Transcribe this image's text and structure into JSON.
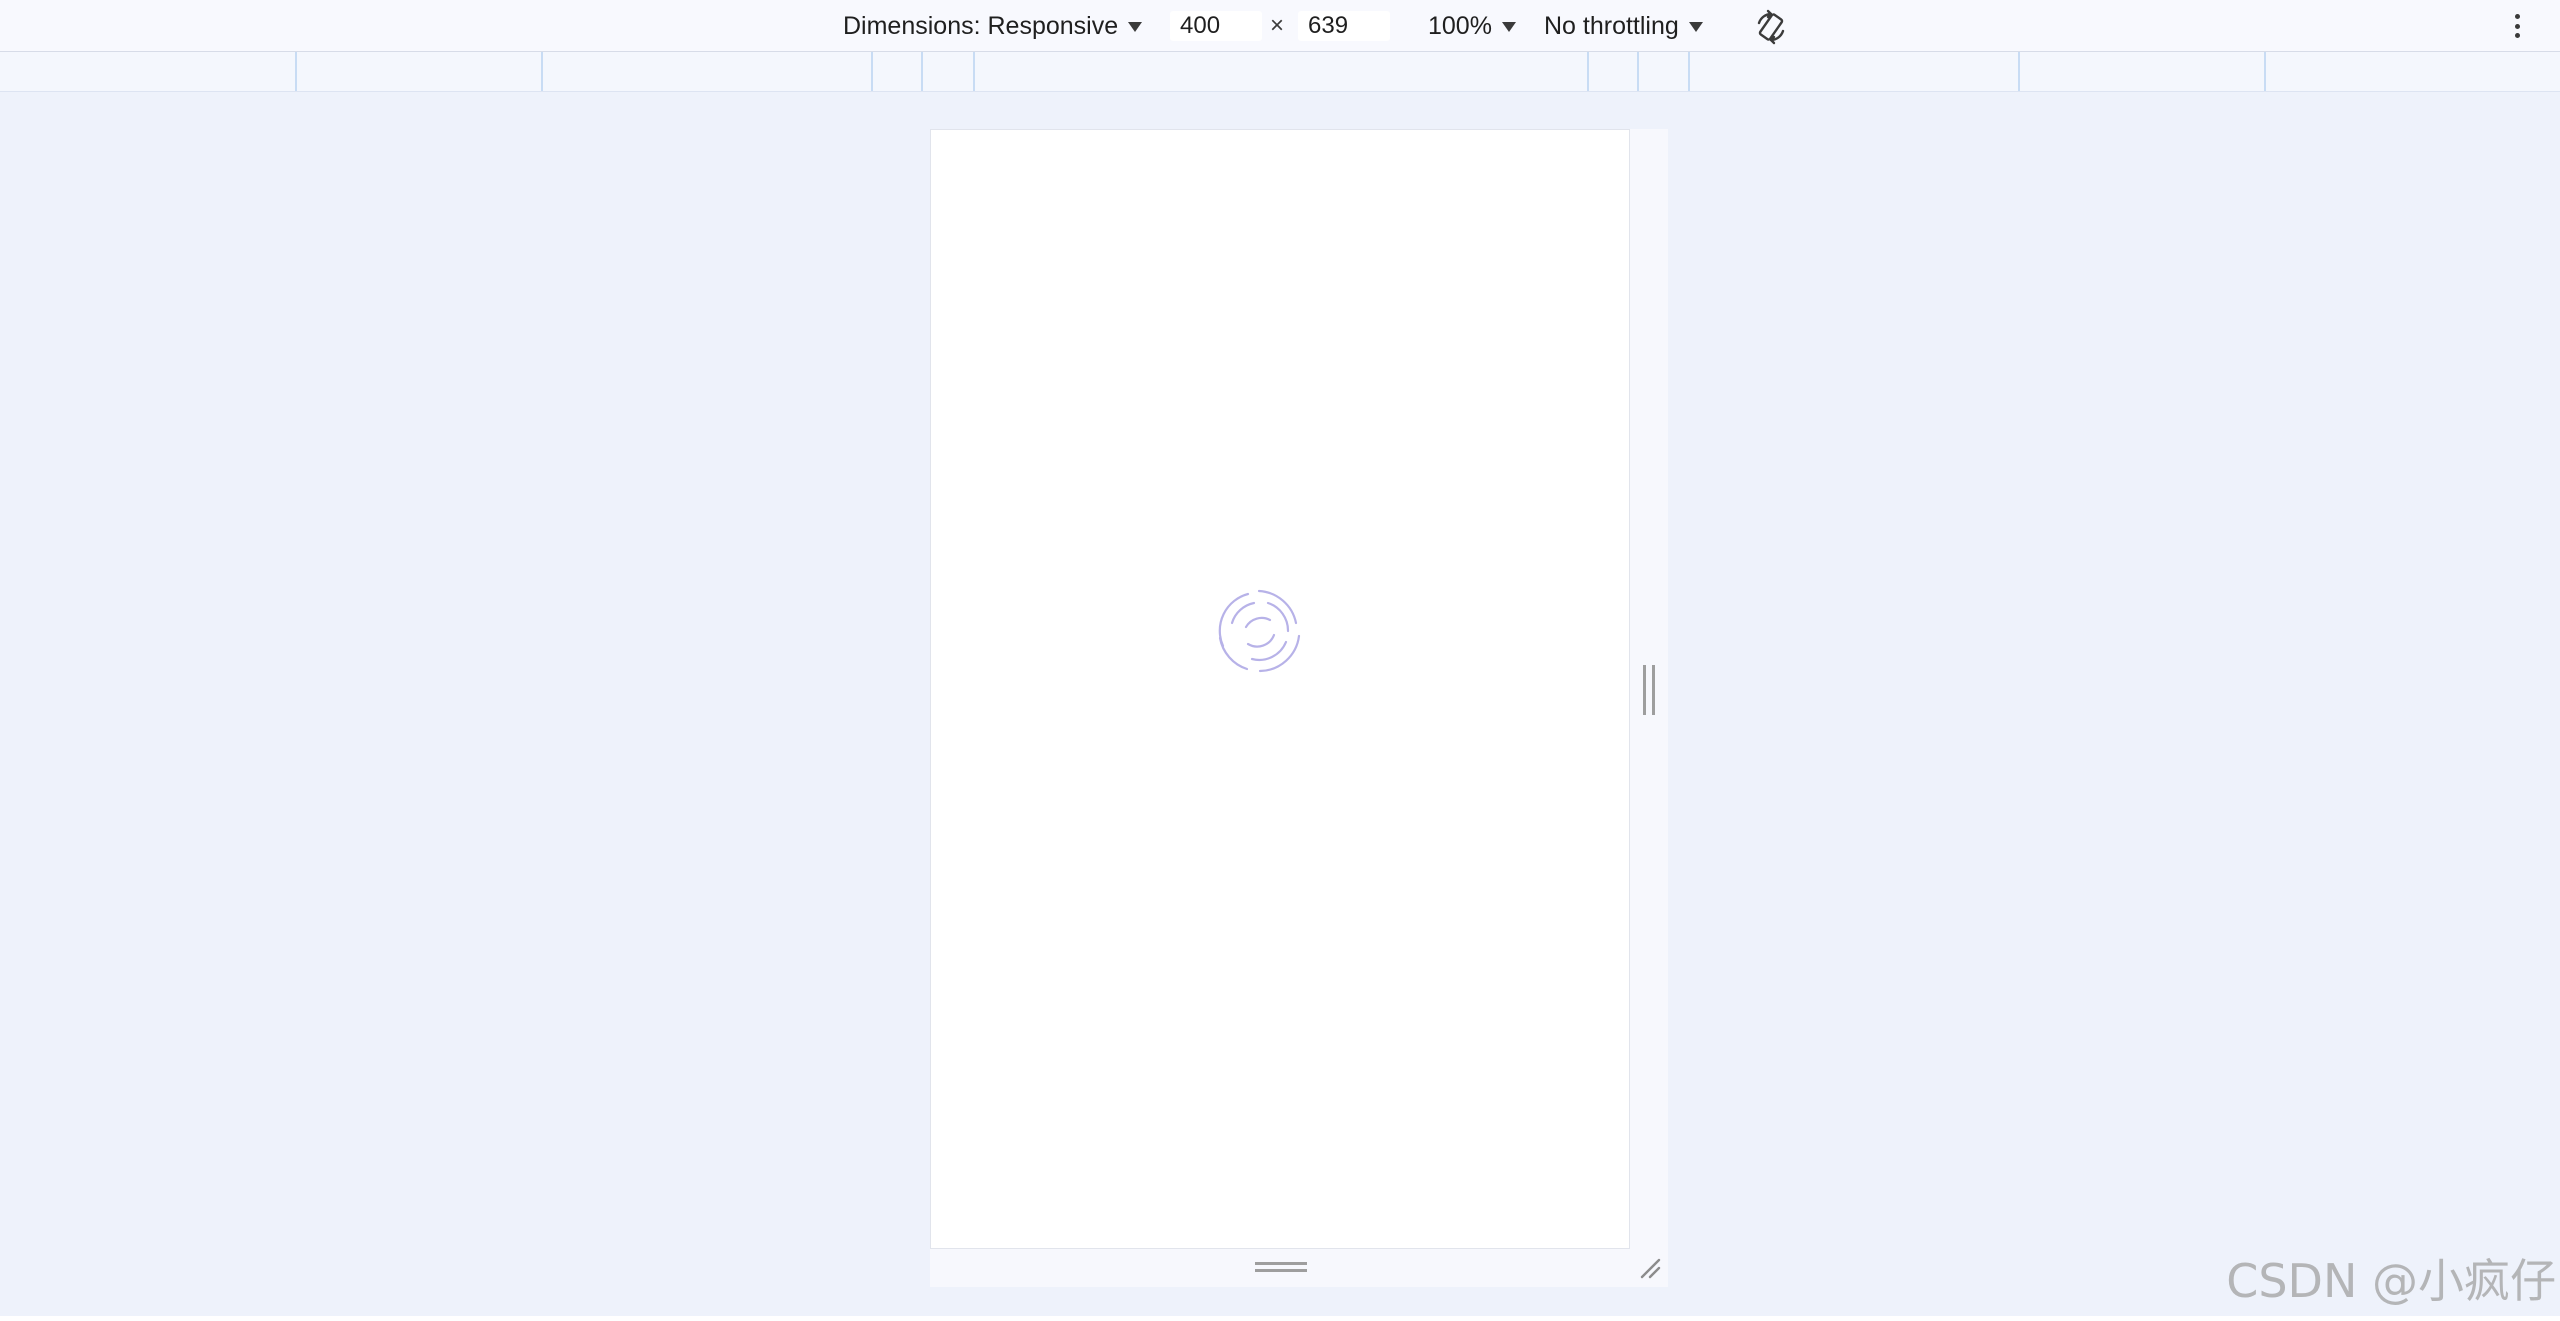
{
  "toolbar": {
    "dimensions_label": "Dimensions: Responsive",
    "width_value": "400",
    "times_symbol": "×",
    "height_value": "639",
    "zoom_label": "100%",
    "throttling_label": "No throttling",
    "rotate_icon": "rotate-icon",
    "more_icon": "more-vertical-icon"
  },
  "viewport": {
    "content_state": "loading",
    "spinner_icon": "loading-spinner-icon",
    "spinner_color": "#b7b2e8"
  },
  "colors": {
    "canvas_background": "#eef2fb",
    "toolbar_background": "#f8f9fe",
    "media_query_line": "#c8dcf4"
  },
  "watermark": {
    "text": "CSDN @小疯仔"
  }
}
